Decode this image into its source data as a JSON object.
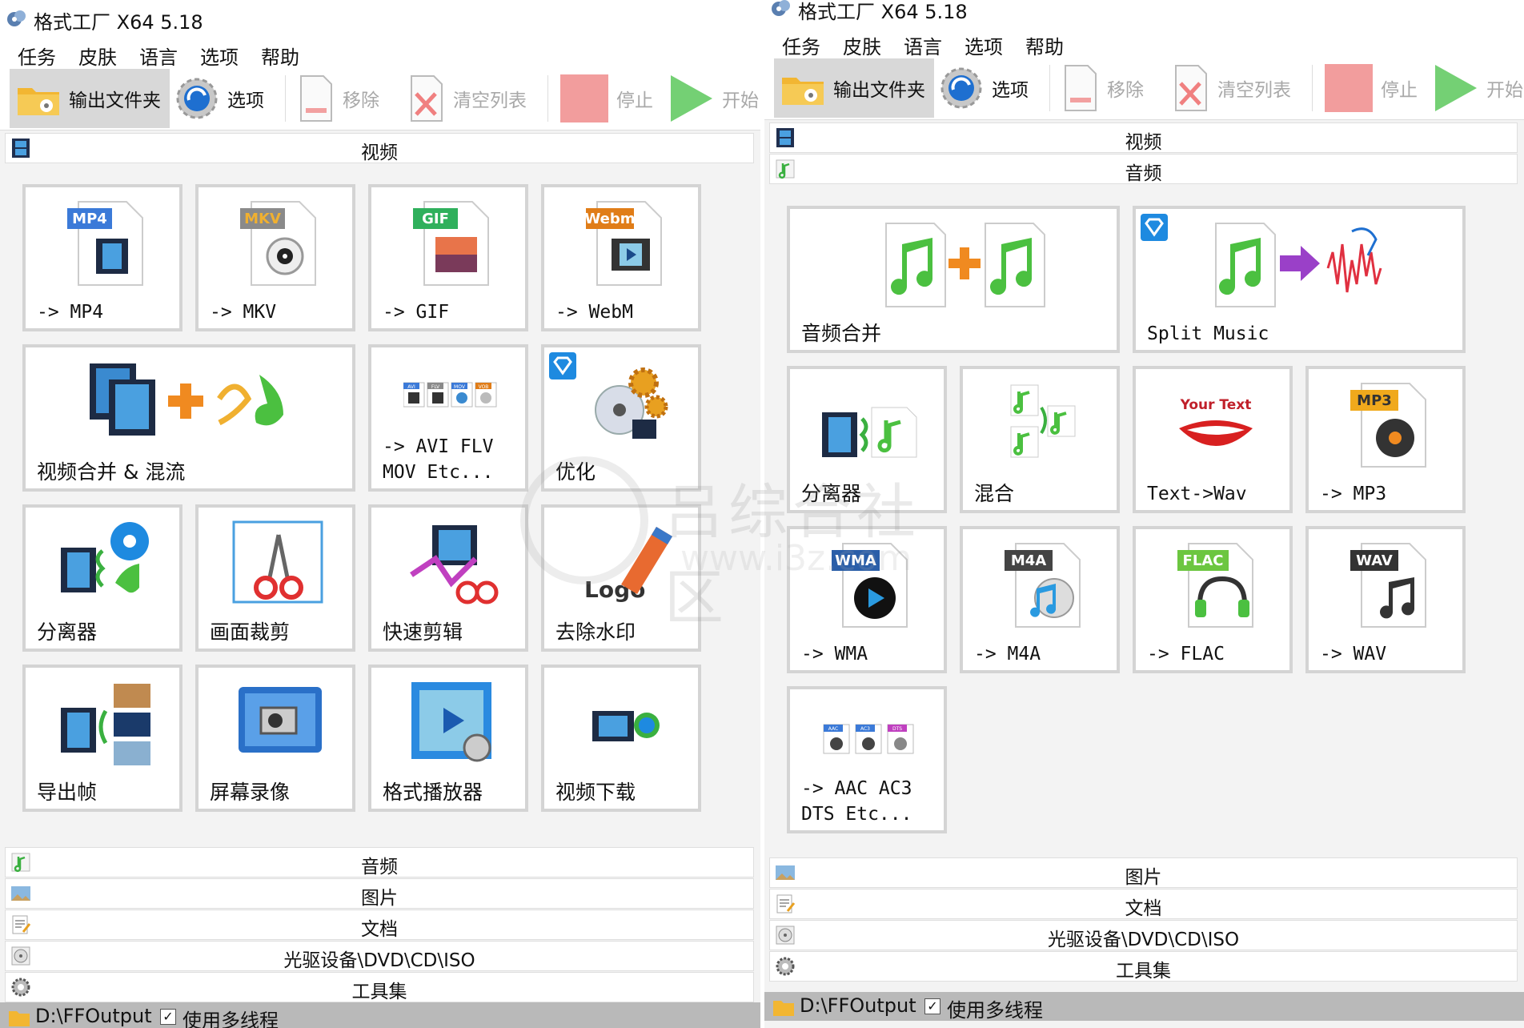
{
  "window": {
    "title": "格式工厂 X64 5.18"
  },
  "menu": [
    "任务",
    "皮肤",
    "语言",
    "选项",
    "帮助"
  ],
  "toolbar": {
    "output_folder": "输出文件夹",
    "options": "选项",
    "remove": "移除",
    "clear_list": "清空列表",
    "stop": "停止",
    "start": "开始"
  },
  "categories": {
    "video": "视频",
    "audio": "音频",
    "picture": "图片",
    "document": "文档",
    "rom": "光驱设备\\DVD\\CD\\ISO",
    "tools": "工具集"
  },
  "left": {
    "video_tiles": [
      {
        "label": "-> MP4",
        "badge": "MP4"
      },
      {
        "label": "-> MKV",
        "badge": "MKV"
      },
      {
        "label": "-> GIF",
        "badge": "GIF"
      },
      {
        "label": "-> WebM",
        "badge": "Webm"
      },
      {
        "label": "视频合并 & 混流"
      },
      {
        "label": "-> AVI FLV\nMOV Etc...",
        "mini_badges": [
          "AVI",
          "FLV",
          "MOV",
          "VOB"
        ]
      },
      {
        "label": "优化"
      },
      {
        "label": "分离器"
      },
      {
        "label": "画面裁剪"
      },
      {
        "label": "快速剪辑"
      },
      {
        "label": "去除水印",
        "logo_text": "Logo"
      },
      {
        "label": "导出帧"
      },
      {
        "label": "屏幕录像"
      },
      {
        "label": "格式播放器"
      },
      {
        "label": "视频下载"
      }
    ]
  },
  "right": {
    "audio_tiles": [
      {
        "label": "音频合并"
      },
      {
        "label": "Split Music"
      },
      {
        "label": "分离器"
      },
      {
        "label": "混合"
      },
      {
        "label": "Text->Wav",
        "icon_text": "Your Text"
      },
      {
        "label": "-> MP3",
        "badge": "MP3"
      },
      {
        "label": "-> WMA",
        "badge": "WMA"
      },
      {
        "label": "-> M4A",
        "badge": "M4A"
      },
      {
        "label": "-> FLAC",
        "badge": "FLAC"
      },
      {
        "label": "-> WAV",
        "badge": "WAV"
      },
      {
        "label": "-> AAC AC3\nDTS Etc...",
        "mini_badges": [
          "AAC",
          "AC3",
          "DTS"
        ]
      }
    ]
  },
  "status": {
    "output_path": "D:\\FFOutput",
    "multithread_label": "使用多线程",
    "multithread_checked": "✓"
  },
  "watermark": {
    "line1": "吕综合社区",
    "line2": "www.i3z.com"
  },
  "colors": {
    "mp4": "#3b7ad8",
    "mkv": "#8a8a8a",
    "gif": "#2fb05c",
    "webm": "#e07d18",
    "mp3": "#f0a91c",
    "wma": "#2a5ea8",
    "m4a": "#444444",
    "flac": "#6cc640",
    "wav": "#333333",
    "stop": "#f08c8c",
    "start": "#5cc85c",
    "status_bar": "#b9b9b9"
  }
}
